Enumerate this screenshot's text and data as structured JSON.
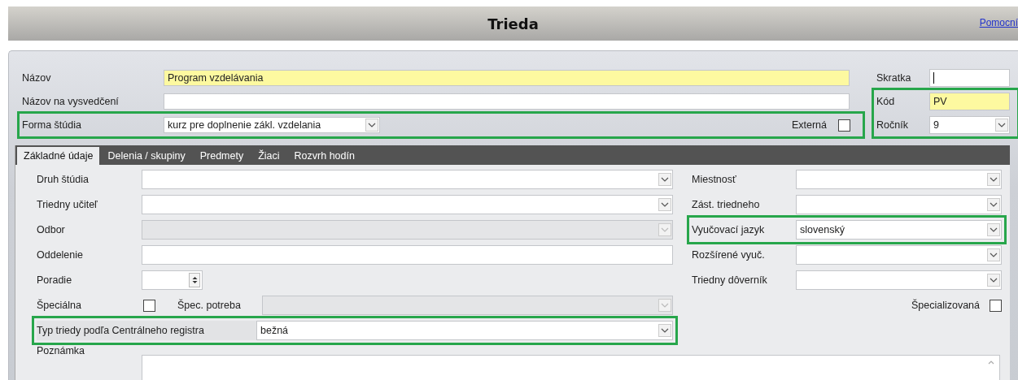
{
  "window": {
    "title": "Trieda",
    "help_link": "Pomocní"
  },
  "header": {
    "left": [
      {
        "label": "Názov",
        "kind": "text",
        "value": "Program vzdelávania",
        "required": true,
        "outlined": false
      },
      {
        "label": "Názov na vysvedčení",
        "kind": "text",
        "required": false,
        "outlined": false
      },
      {
        "label": "Forma štúdia",
        "kind": "combo",
        "value": "kurz pre doplnenie zákl. vzdelania",
        "required": false,
        "outlined": true
      }
    ],
    "external": {
      "label": "Externá",
      "checked": false
    },
    "right": [
      {
        "label": "Skratka",
        "kind": "text",
        "required": false,
        "focused": true
      }
    ],
    "right_group": {
      "outlined": true,
      "fields": [
        {
          "label": "Kód",
          "kind": "text",
          "value": "PV",
          "required": true
        },
        {
          "label": "Ročník",
          "kind": "combo",
          "value": "9",
          "required": false
        }
      ]
    }
  },
  "tabs": [
    {
      "label": "Základné údaje",
      "selected": true
    },
    {
      "label": "Delenia / skupiny",
      "selected": false
    },
    {
      "label": "Predmety",
      "selected": false
    },
    {
      "label": "Žiaci",
      "selected": false
    },
    {
      "label": "Rozvrh hodín",
      "selected": false
    }
  ],
  "left_fields": [
    {
      "label": "Druh štúdia",
      "kind": "combo",
      "disabled": false,
      "outlined": false
    },
    {
      "label": "Triedny učiteľ",
      "kind": "combo",
      "disabled": false,
      "outlined": false
    },
    {
      "label": "Odbor",
      "kind": "combo",
      "disabled": true,
      "outlined": false
    },
    {
      "label": "Oddelenie",
      "kind": "text",
      "disabled": false,
      "outlined": false
    },
    {
      "label": "Poradie",
      "kind": "spin",
      "disabled": false,
      "outlined": false
    },
    {
      "label": "Špeciálna",
      "kind": "check_combo",
      "checked": false,
      "sub_label": "Špec. potreba",
      "disabled": true,
      "outlined": false
    },
    {
      "label": "Typ triedy podľa Centrálneho registra",
      "kind": "wide_combo",
      "value": "bežná",
      "disabled": false,
      "outlined": true
    }
  ],
  "right_fields": [
    {
      "label": "Miestnosť",
      "kind": "combo",
      "outlined": false
    },
    {
      "label": "Zást. triedneho",
      "kind": "combo",
      "outlined": false
    },
    {
      "label": "Vyučovací jazyk",
      "kind": "combo",
      "value": "slovenský",
      "outlined": true
    },
    {
      "label": "Rozšírené vyuč.",
      "kind": "combo",
      "outlined": false
    },
    {
      "label": "Triedny dôverník",
      "kind": "combo",
      "outlined": false
    }
  ],
  "specialized": {
    "label": "Špecializovaná",
    "checked": false
  },
  "note": {
    "label": "Poznámka"
  }
}
